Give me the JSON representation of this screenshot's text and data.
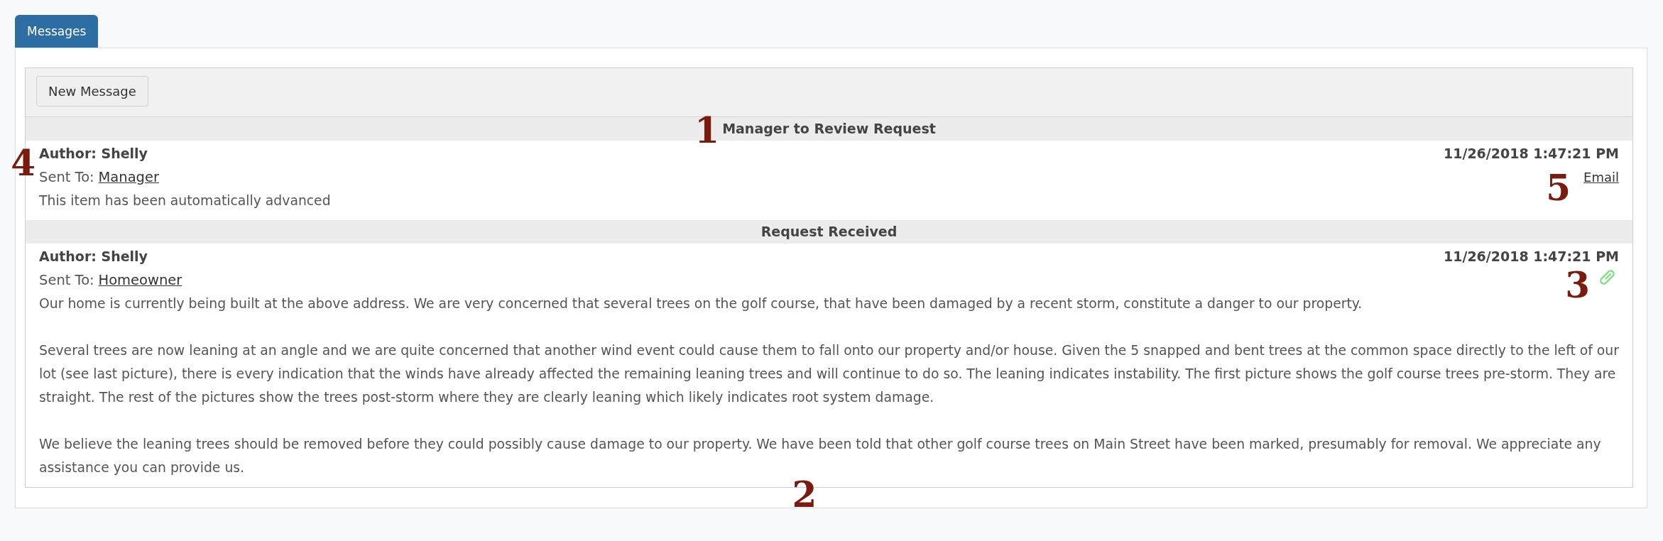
{
  "tabs": [
    {
      "label": "Messages",
      "selected": true
    }
  ],
  "toolbar": {
    "new_message_button": "New Message"
  },
  "messages": [
    {
      "title": "Manager to Review Request",
      "title_callout": "1",
      "author": "Author: Shelly",
      "author_callout": "4",
      "sent_to_label": "Sent To:",
      "recipient": "Manager",
      "timestamp": "11/26/2018 1:47:21 PM",
      "action": {
        "kind": "link",
        "label": "Email",
        "callout": "5"
      },
      "body": [
        "This item has been automatically advanced"
      ]
    },
    {
      "title": "Request Received",
      "author": "Author: Shelly",
      "sent_to_label": "Sent To:",
      "recipient": "Homeowner",
      "timestamp": "11/26/2018 1:47:21 PM",
      "action": {
        "kind": "attachment",
        "callout": "3"
      },
      "body": [
        "Our home is currently being built at the above address. We are very concerned that several trees on the golf course, that have been damaged by a recent storm, constitute a danger to our property.",
        "Several trees are now leaning at an angle and we are quite concerned that another wind event could cause them to fall onto our property and/or house. Given the 5 snapped and bent trees at the common space directly to the left of our lot (see last picture), there is every indication that the winds have already affected the remaining leaning trees and will continue to do so. The leaning indicates instability. The first picture shows the golf course trees pre-storm. They are straight. The rest of the pictures show the trees post-storm where they are clearly leaning which likely indicates root system damage.",
        "We believe the leaning trees should be removed before they could possibly cause damage to our property. We have been told that other golf course trees on Main Street have been marked, presumably for removal. We appreciate any assistance you can provide us."
      ],
      "body_callout": "2"
    }
  ]
}
